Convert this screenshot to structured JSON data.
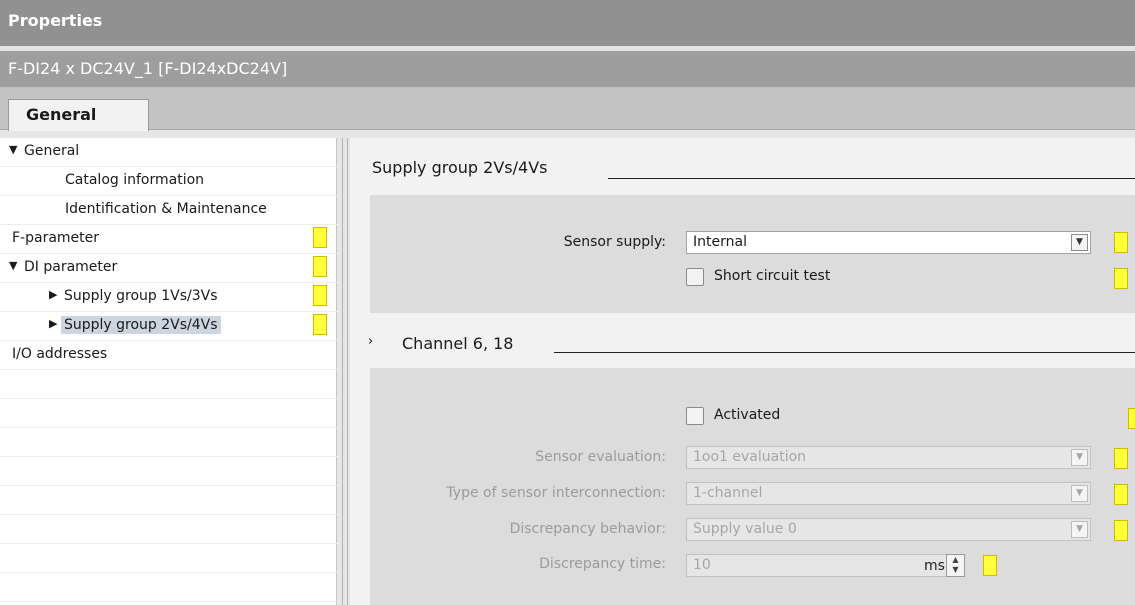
{
  "window": {
    "title": "Properties"
  },
  "object": {
    "name": "F-DI24 x DC24V_1 [F-DI24xDC24V]"
  },
  "tabs": [
    {
      "label": "General"
    }
  ],
  "tree": {
    "items": [
      {
        "label": "General",
        "expanded": true
      },
      {
        "label": "Catalog information"
      },
      {
        "label": "Identification & Maintenance"
      },
      {
        "label": "F-parameter"
      },
      {
        "label": "DI parameter",
        "expanded": true
      },
      {
        "label": "Supply group 1Vs/3Vs"
      },
      {
        "label": "Supply group 2Vs/4Vs",
        "selected": true
      },
      {
        "label": "I/O addresses"
      }
    ]
  },
  "supply_section": {
    "title": "Supply group 2Vs/4Vs",
    "sensor_supply_label": "Sensor supply:",
    "sensor_supply_value": "Internal",
    "short_circuit_label": "Short circuit test",
    "short_circuit_checked": false
  },
  "channel_section": {
    "title": "Channel 6, 18",
    "activated_label": "Activated",
    "activated_checked": false,
    "sensor_eval_label": "Sensor evaluation:",
    "sensor_eval_value": "1oo1 evaluation",
    "interconnection_label": "Type of sensor interconnection:",
    "interconnection_value": "1-channel",
    "discrepancy_behavior_label": "Discrepancy behavior:",
    "discrepancy_behavior_value": "Supply value 0",
    "discrepancy_time_label": "Discrepancy time:",
    "discrepancy_time_value": "10",
    "discrepancy_time_unit": "ms"
  },
  "colors": {
    "flag": "#ffff3a",
    "selection": "#ccd6e2",
    "titlebar": "#919191"
  }
}
